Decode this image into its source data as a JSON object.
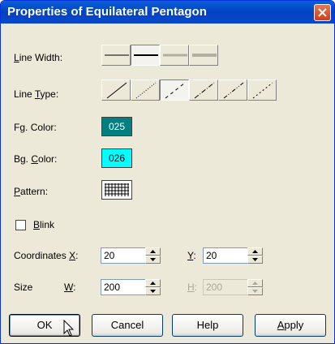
{
  "window": {
    "title": "Properties of Equilateral Pentagon"
  },
  "line_width": {
    "label_pre": "",
    "label_acc": "L",
    "label_post": "ine Width:",
    "options": 4,
    "selected_index": 1
  },
  "line_type": {
    "label_pre": "Line ",
    "label_acc": "T",
    "label_post": "ype:",
    "options": 6,
    "selected_index": 2
  },
  "fg_color": {
    "label_pre": "F",
    "label_acc": "g",
    "label_post": ". Color:",
    "value": "025",
    "color": "#008080",
    "text_color": "#ffffff"
  },
  "bg_color": {
    "label_pre": "Bg. ",
    "label_acc": "C",
    "label_post": "olor:",
    "value": "026",
    "color": "#00ffff",
    "text_color": "#000000"
  },
  "pattern": {
    "label_pre": "",
    "label_acc": "P",
    "label_post": "attern:"
  },
  "blink": {
    "label_pre": "",
    "label_acc": "B",
    "label_post": "link",
    "checked": false
  },
  "coordinates": {
    "label": "Coordinates",
    "x_label_acc": "X",
    "x_label_post": ":",
    "x_value": "20",
    "y_label_acc": "Y",
    "y_label_post": ":",
    "y_value": "20"
  },
  "size": {
    "label": "Size",
    "w_label_acc": "W",
    "w_label_post": ":",
    "w_value": "200",
    "h_label_acc": "H",
    "h_label_post": ":",
    "h_value": "200",
    "h_disabled": true
  },
  "buttons": {
    "ok": "OK",
    "cancel": "Cancel",
    "help": "Help",
    "apply_acc": "A",
    "apply_post": "pply"
  }
}
